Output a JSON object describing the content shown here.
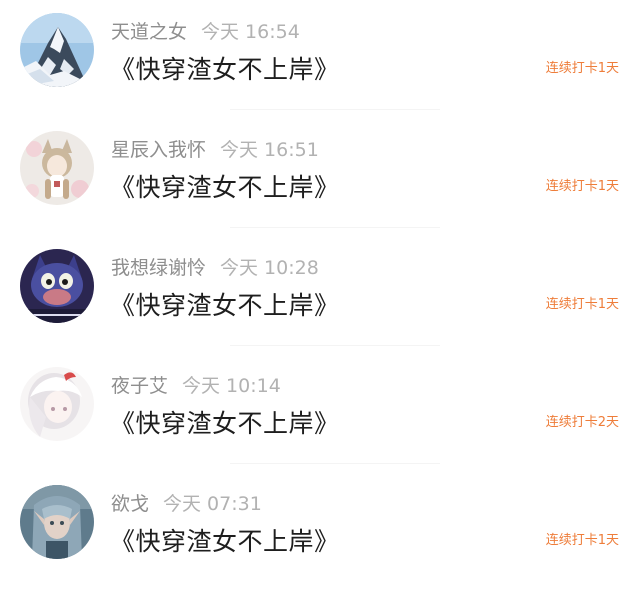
{
  "posts": [
    {
      "username": "天道之女",
      "time": "今天 16:54",
      "title": "《快穿渣女不上岸》",
      "streak": "连续打卡1天",
      "avatar_icon": "snowy-mountain-avatar"
    },
    {
      "username": "星辰入我怀",
      "time": "今天 16:51",
      "title": "《快穿渣女不上岸》",
      "streak": "连续打卡1天",
      "avatar_icon": "anime-girl-avatar"
    },
    {
      "username": "我想绿谢怜",
      "time": "今天 10:28",
      "title": "《快穿渣女不上岸》",
      "streak": "连续打卡1天",
      "avatar_icon": "cartoon-cat-avatar"
    },
    {
      "username": "夜子艾",
      "time": "今天 10:14",
      "title": "《快穿渣女不上岸》",
      "streak": "连续打卡2天",
      "avatar_icon": "white-hair-girl-avatar"
    },
    {
      "username": "欲戈",
      "time": "今天 07:31",
      "title": "《快穿渣女不上岸》",
      "streak": "连续打卡1天",
      "avatar_icon": "elf-portrait-avatar"
    }
  ],
  "colors": {
    "username": "#8e8e8e",
    "time": "#b2b2b2",
    "title": "#1e1e1e",
    "streak_accent": "#ee7d3a"
  }
}
